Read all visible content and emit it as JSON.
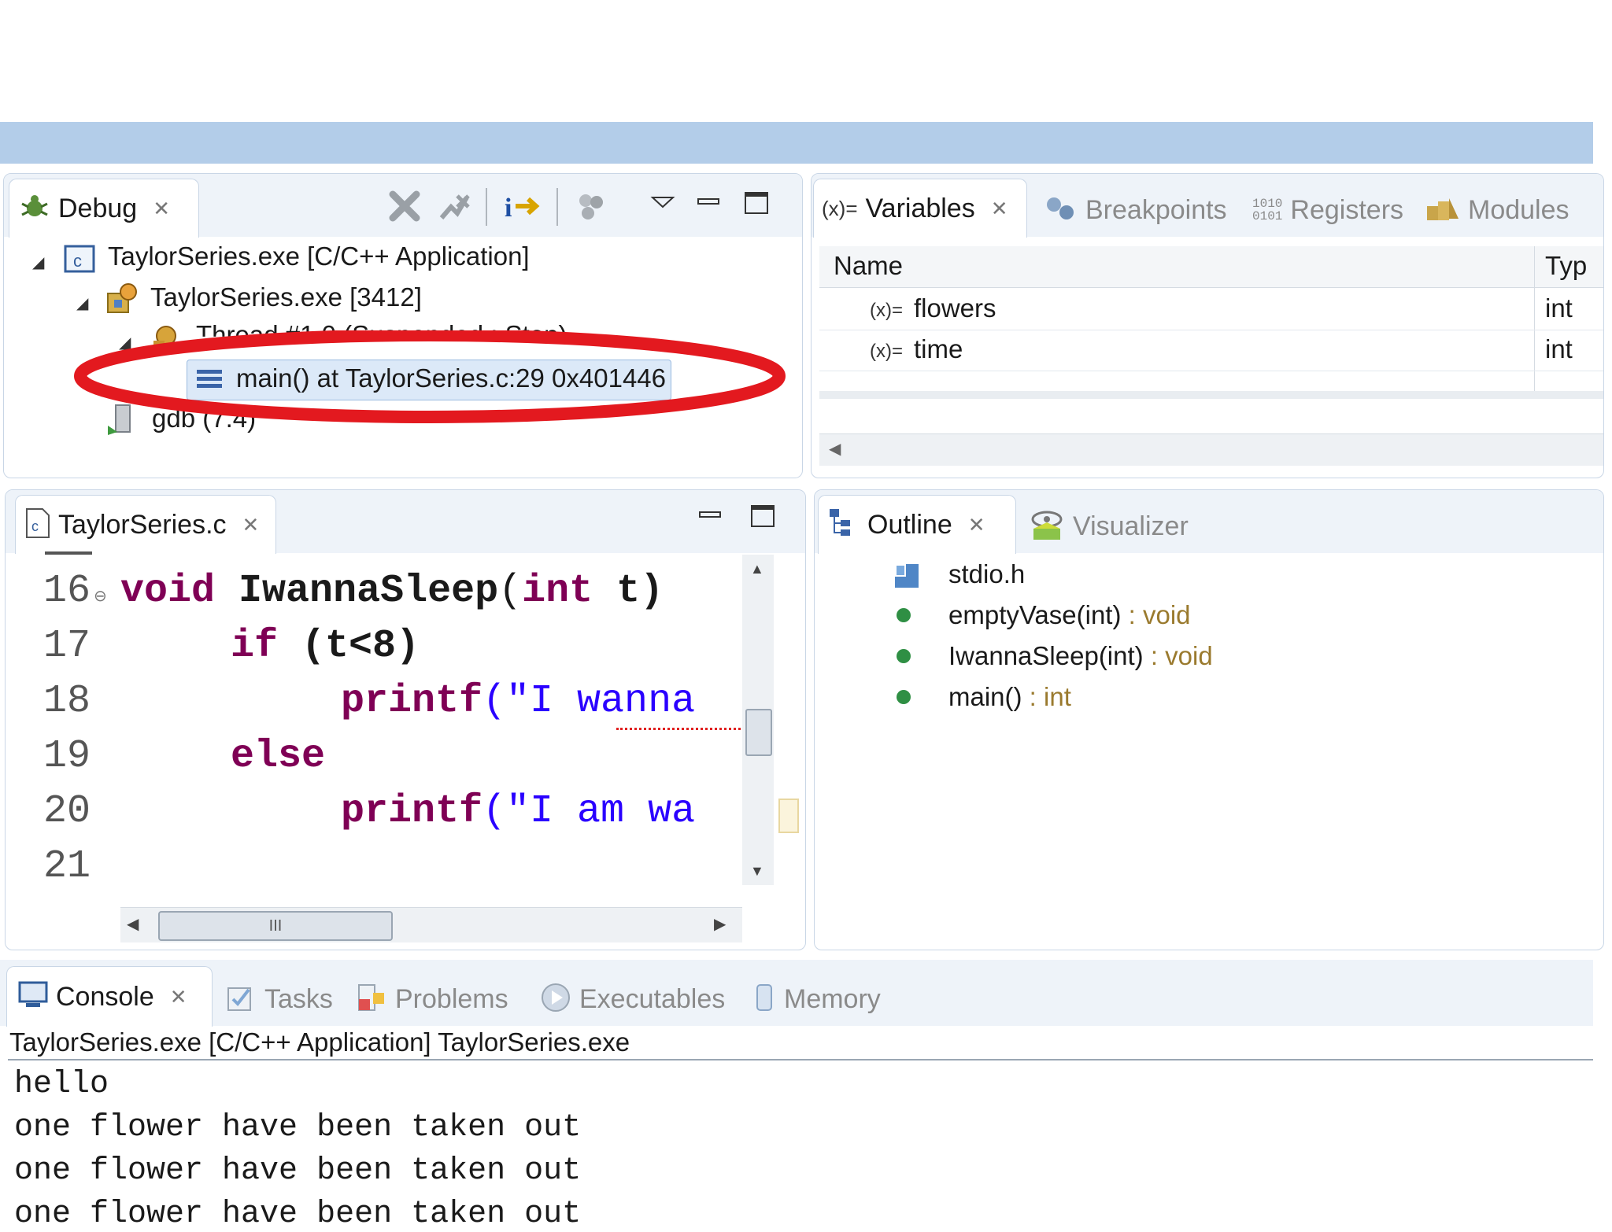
{
  "debug": {
    "tab": "Debug",
    "tree": {
      "app": "TaylorSeries.exe [C/C++ Application]",
      "process": "TaylorSeries.exe [3412]",
      "thread": "Thread #1 0 (Suspended : Step)",
      "frame": "main() at TaylorSeries.c:29 0x401446",
      "gdb": "gdb (7.4)"
    }
  },
  "variables": {
    "tabs": [
      "Variables",
      "Breakpoints",
      "Registers",
      "Modules"
    ],
    "columns": [
      "Name",
      "Typ"
    ],
    "rows": [
      {
        "name": "flowers",
        "type": "int"
      },
      {
        "name": "time",
        "type": "int"
      }
    ]
  },
  "editor": {
    "tab": "TaylorSeries.c",
    "lines": [
      "16",
      "17",
      "18",
      "19",
      "20",
      "21"
    ],
    "code": {
      "l16_kw": "void",
      "l16_fn": "IwannaSleep",
      "l16_rest": "(",
      "l16_kw2": "int",
      "l16_tail": " t)",
      "l17_kw": "if",
      "l17_rest": " (t<8)",
      "l18_fn": "printf",
      "l18_str": "(\"I wanna",
      "l19_kw": "else",
      "l20_fn": "printf",
      "l20_str": "(\"I am wa"
    },
    "hscroll_grip": "III"
  },
  "outline": {
    "tabs": [
      "Outline",
      "Visualizer"
    ],
    "items": [
      {
        "name": "stdio.h",
        "type": ""
      },
      {
        "name": "emptyVase(int)",
        "type": " : void"
      },
      {
        "name": "IwannaSleep(int)",
        "type": " : void"
      },
      {
        "name": "main()",
        "type": " : int"
      }
    ]
  },
  "console": {
    "tabs": [
      "Console",
      "Tasks",
      "Problems",
      "Executables",
      "Memory"
    ],
    "header": "TaylorSeries.exe [C/C++ Application] TaylorSeries.exe",
    "lines": [
      "hello",
      "one flower have been taken out",
      "one flower have been taken out",
      "one flower have been taken out"
    ]
  },
  "colors": {
    "topbar": "#b3cde9",
    "highlight_ring": "#e3191f",
    "selection": "#dce9f8",
    "keyword": "#7f0055",
    "string": "#2a00ff"
  }
}
